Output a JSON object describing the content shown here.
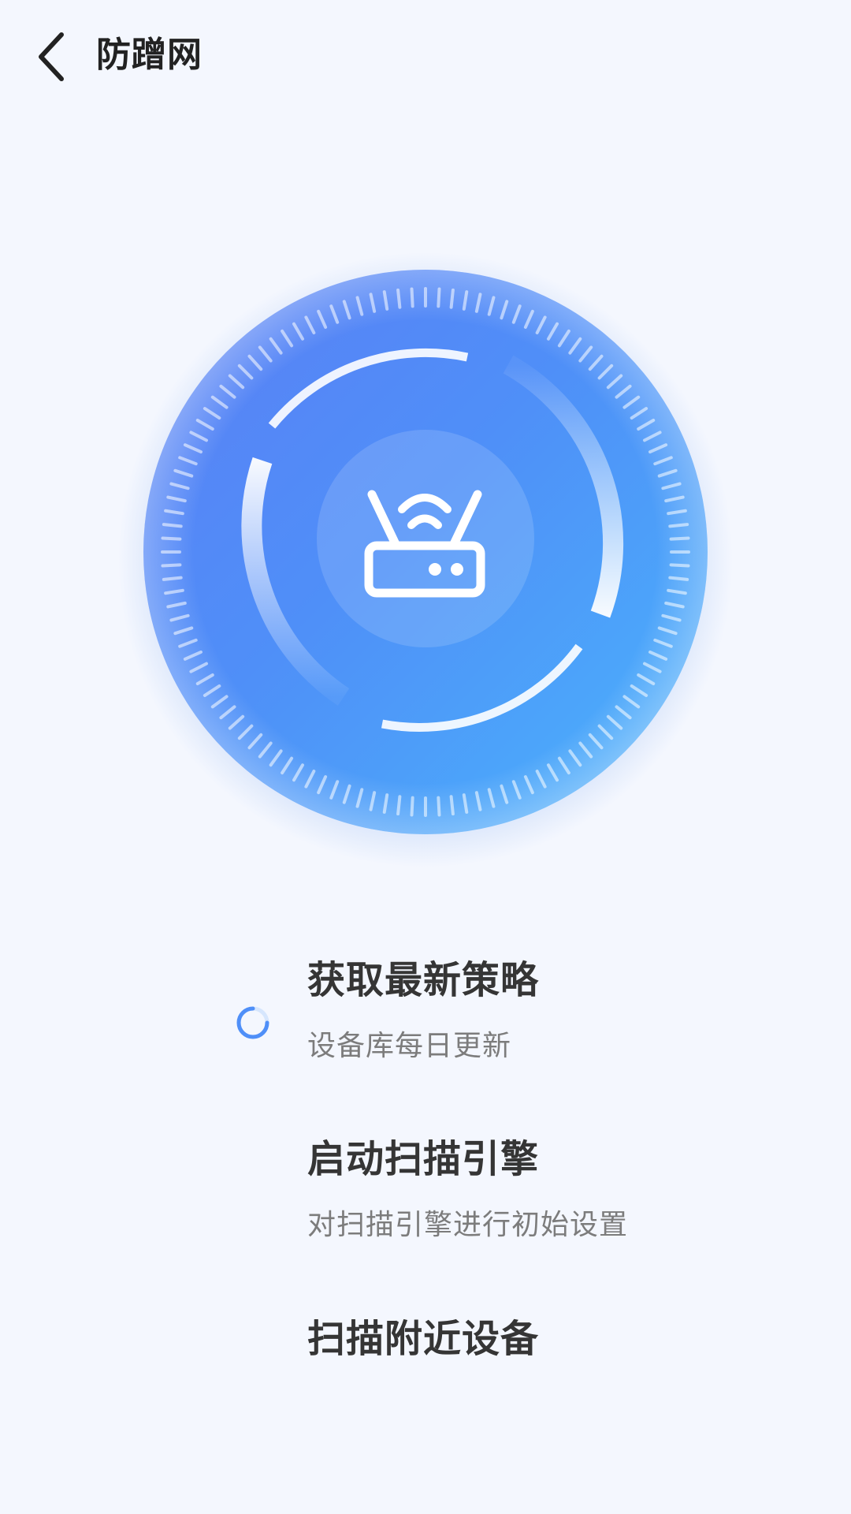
{
  "header": {
    "title": "防蹭网"
  },
  "scanner": {
    "icon": "router-icon",
    "accent_color": "#4f8ff8"
  },
  "steps": [
    {
      "title": "获取最新策略",
      "desc": "设备库每日更新",
      "status": "loading"
    },
    {
      "title": "启动扫描引擎",
      "desc": "对扫描引擎进行初始设置",
      "status": "pending"
    },
    {
      "title": "扫描附近设备",
      "status": "pending"
    }
  ]
}
